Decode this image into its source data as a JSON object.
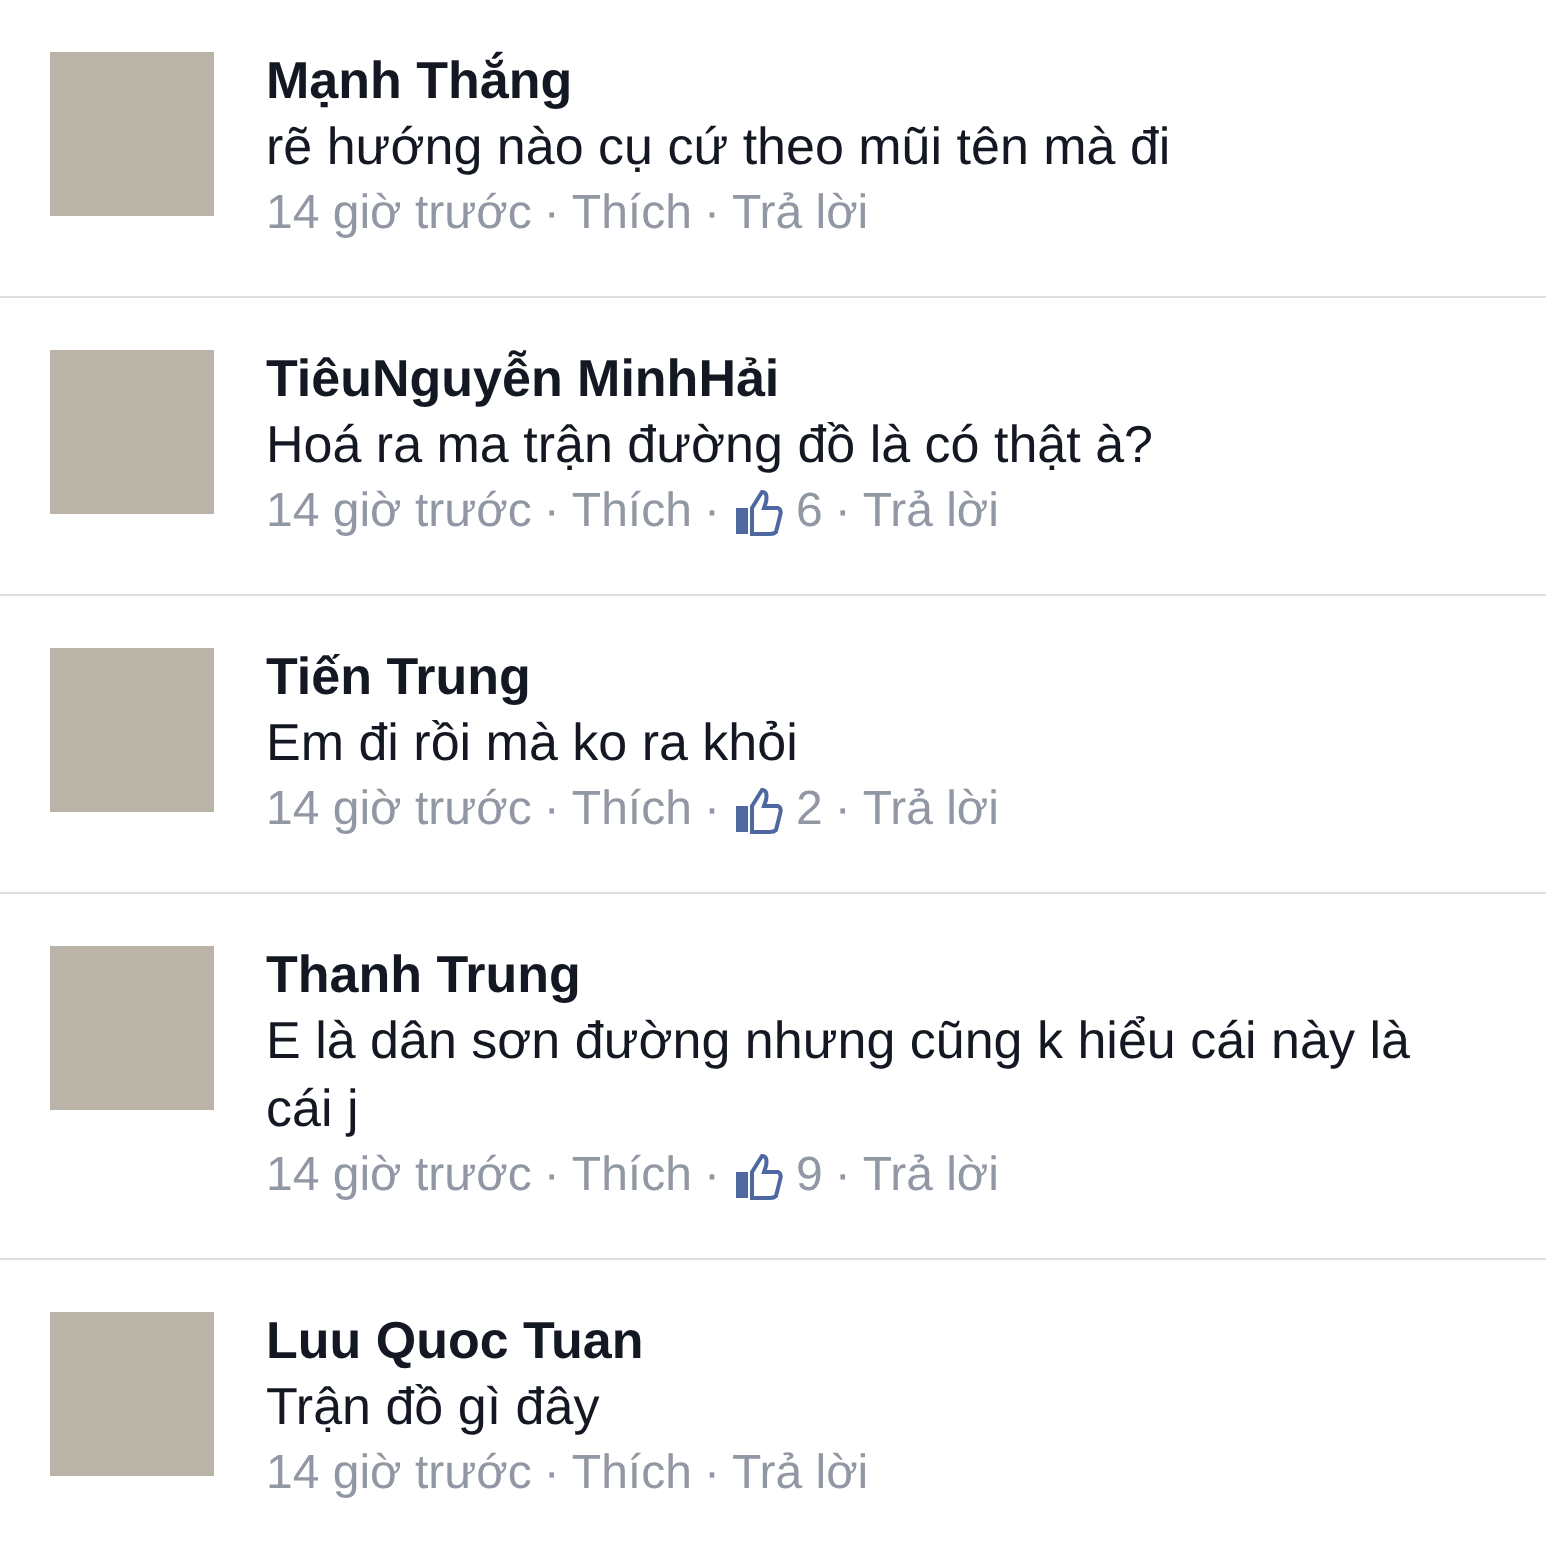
{
  "comments": [
    {
      "author": "Mạnh Thắng",
      "text": "rẽ hướng nào cụ cứ theo mũi tên mà đi",
      "meta": [
        {
          "kind": "time",
          "text": "14 giờ trước"
        },
        {
          "kind": "dot",
          "text": "·"
        },
        {
          "kind": "link",
          "text": "Thích"
        },
        {
          "kind": "dot",
          "text": "·"
        },
        {
          "kind": "link",
          "text": "Trả lời"
        }
      ]
    },
    {
      "author": "TiêuNguyễn MinhHải",
      "text": "Hoá ra ma trận đường đồ là có thật à?",
      "meta": [
        {
          "kind": "time",
          "text": "14 giờ trước"
        },
        {
          "kind": "dot",
          "text": "·"
        },
        {
          "kind": "link",
          "text": "Thích"
        },
        {
          "kind": "dot",
          "text": "·"
        },
        {
          "kind": "likes",
          "text": "6"
        },
        {
          "kind": "dot",
          "text": "·"
        },
        {
          "kind": "link",
          "text": "Trả lời"
        }
      ]
    },
    {
      "author": "Tiến Trung",
      "text": "Em đi rồi mà ko ra khỏi",
      "meta": [
        {
          "kind": "time",
          "text": "14 giờ trước"
        },
        {
          "kind": "dot",
          "text": "·"
        },
        {
          "kind": "link",
          "text": "Thích"
        },
        {
          "kind": "dot",
          "text": "·"
        },
        {
          "kind": "likes",
          "text": "2"
        },
        {
          "kind": "dot",
          "text": "·"
        },
        {
          "kind": "link",
          "text": "Trả lời"
        }
      ]
    },
    {
      "author": "Thanh Trung",
      "text": "E là dân sơn đường nhưng cũng k hiểu cái này là cái j",
      "meta": [
        {
          "kind": "time",
          "text": "14 giờ trước"
        },
        {
          "kind": "dot",
          "text": "·"
        },
        {
          "kind": "link",
          "text": "Thích"
        },
        {
          "kind": "dot",
          "text": "·"
        },
        {
          "kind": "likes",
          "text": "9"
        },
        {
          "kind": "dot",
          "text": "·"
        },
        {
          "kind": "link",
          "text": "Trả lời"
        }
      ]
    },
    {
      "author": "Luu Quoc Tuan",
      "text": "Trận đồ gì đây",
      "meta": [
        {
          "kind": "time",
          "text": "14 giờ trước"
        },
        {
          "kind": "dot",
          "text": "·"
        },
        {
          "kind": "link",
          "text": "Thích"
        },
        {
          "kind": "dot",
          "text": "·"
        },
        {
          "kind": "link",
          "text": "Trả lời"
        }
      ]
    }
  ]
}
